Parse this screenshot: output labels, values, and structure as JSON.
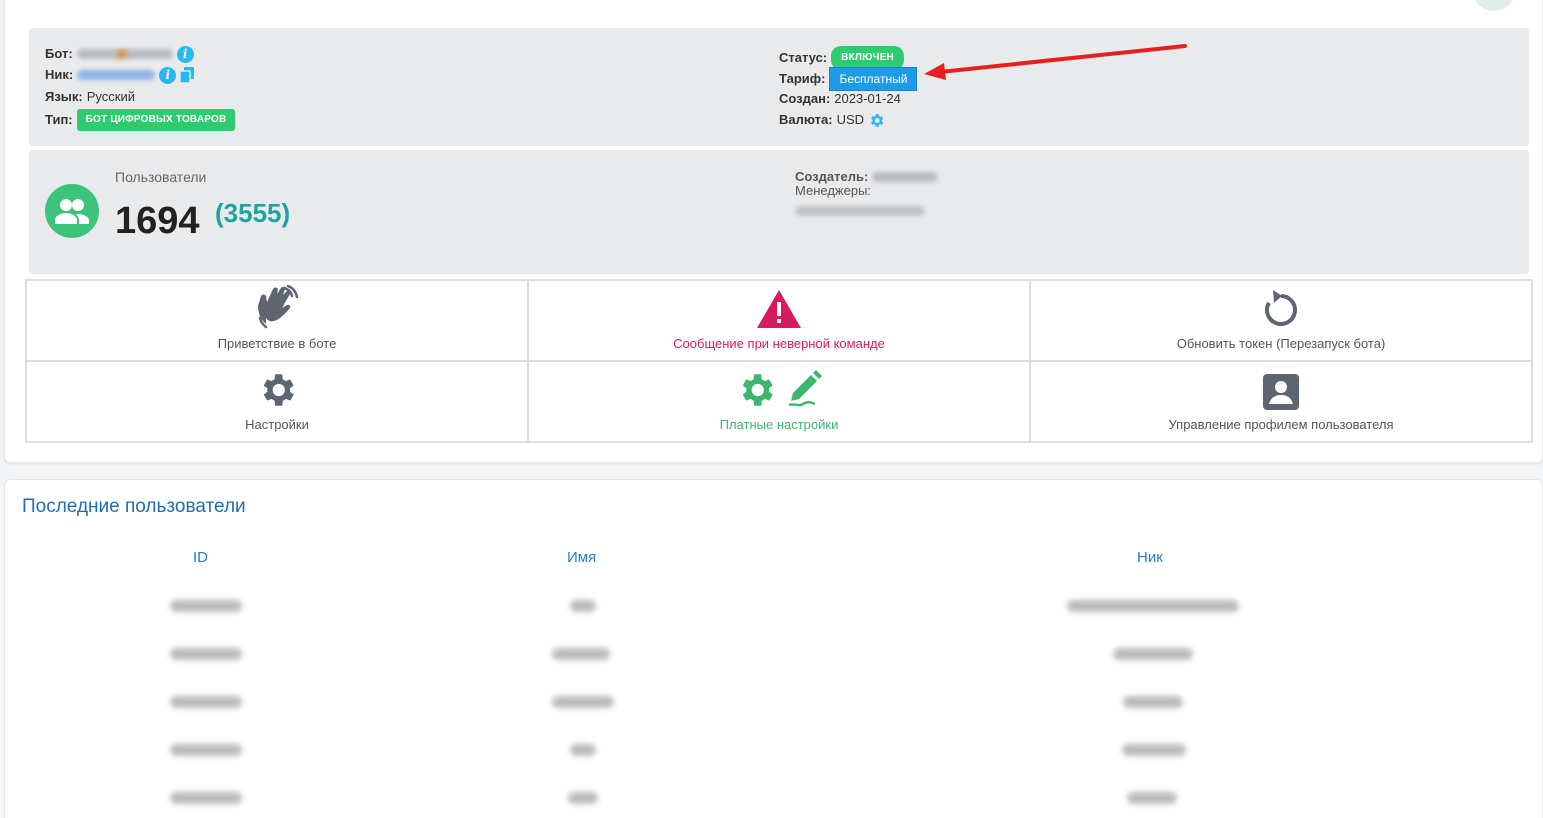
{
  "info": {
    "bot_label": "Бот:",
    "nick_label": "Ник:",
    "lang_label": "Язык:",
    "lang_value": "Русский",
    "type_label": "Тип:",
    "type_badge": "БОТ ЦИФРОВЫХ ТОВАРОВ",
    "status_label": "Статус:",
    "status_badge": "ВКЛЮЧЕН",
    "tariff_label": "Тариф:",
    "tariff_badge": "Бесплатный",
    "created_label": "Создан:",
    "created_value": "2023-01-24",
    "currency_label": "Валюта:",
    "currency_value": "USD"
  },
  "stats": {
    "users_label": "Пользователи",
    "users_count": "1694",
    "users_total": "(3555)",
    "creator_label": "Создатель:",
    "managers_label": "Менеджеры:"
  },
  "actions": [
    {
      "label": "Приветствие в боте",
      "icon": "waving-hand-icon"
    },
    {
      "label": "Сообщение при неверной команде",
      "icon": "warning-icon",
      "color": "#d81b60"
    },
    {
      "label": "Обновить токен (Перезапуск бота)",
      "icon": "refresh-icon"
    },
    {
      "label": "Настройки",
      "icon": "gear-icon"
    },
    {
      "label": "Платные настройки",
      "icon": "gear-edit-icon",
      "color": "#3cb76d"
    },
    {
      "label": "Управление профилем пользователя",
      "icon": "user-profile-icon"
    }
  ],
  "recent": {
    "title": "Последние пользователи",
    "columns": [
      "ID",
      "Имя",
      "Ник"
    ]
  },
  "colors": {
    "accent_green": "#3cc47c",
    "accent_blue": "#1e9be8",
    "danger": "#d81b60",
    "link": "#2a7bc6"
  }
}
